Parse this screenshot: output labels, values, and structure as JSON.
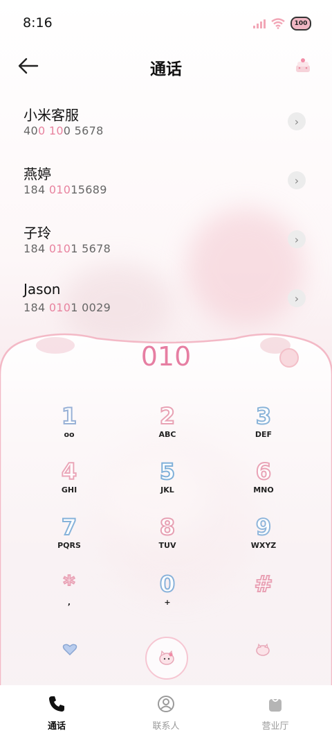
{
  "status_bar": {
    "time": "8:16",
    "battery_label": "100"
  },
  "header": {
    "title": "通话"
  },
  "suggestions": [
    {
      "name": "小米客服",
      "num_pre": "40",
      "num_hl1": "0 10",
      "num_post": "0 5678"
    },
    {
      "name": "燕婷",
      "num_pre": "184 ",
      "num_hl1": "010",
      "num_post": "15689"
    },
    {
      "name": "子玲",
      "num_pre": "184 ",
      "num_hl1": "010",
      "num_post": "1 5678"
    },
    {
      "name": "Jason",
      "num_pre": "184 ",
      "num_hl1": "010",
      "num_post": "1 0029"
    }
  ],
  "dialer": {
    "display": "010",
    "keys": [
      {
        "digit": "1",
        "letters": "ᴏᴏ"
      },
      {
        "digit": "2",
        "letters": "ABC"
      },
      {
        "digit": "3",
        "letters": "DEF"
      },
      {
        "digit": "4",
        "letters": "GHI"
      },
      {
        "digit": "5",
        "letters": "JKL"
      },
      {
        "digit": "6",
        "letters": "MNO"
      },
      {
        "digit": "7",
        "letters": "PQRS"
      },
      {
        "digit": "8",
        "letters": "TUV"
      },
      {
        "digit": "9",
        "letters": "WXYZ"
      },
      {
        "digit": "*",
        "letters": ","
      },
      {
        "digit": "0",
        "letters": "+"
      },
      {
        "digit": "#",
        "letters": ""
      }
    ]
  },
  "tabs": [
    {
      "label": "通话",
      "icon": "phone-icon",
      "active": true
    },
    {
      "label": "联系人",
      "icon": "contacts-icon",
      "active": false
    },
    {
      "label": "营业厅",
      "icon": "shop-bag-icon",
      "active": false
    }
  ],
  "colors": {
    "accent": "#e67ea2",
    "highlight": "#e8839f",
    "panel_border": "#f3b9c6"
  }
}
